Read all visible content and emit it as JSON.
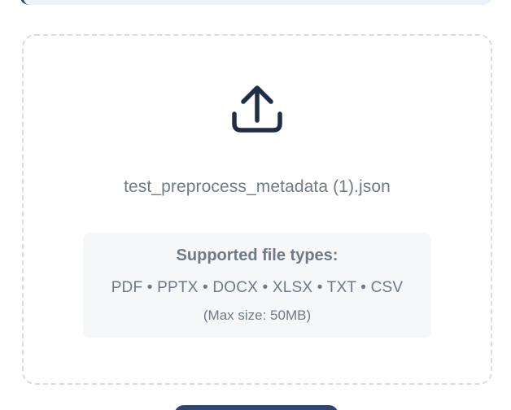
{
  "upload": {
    "icon": "upload-icon",
    "file_name": "test_preprocess_metadata (1).json",
    "supported": {
      "title": "Supported file types:",
      "types": "PDF • PPTX • DOCX • XLSX • TXT • CSV",
      "max_size": "(Max size: 50MB)"
    }
  },
  "colors": {
    "icon": "#1f2d47",
    "text": "#6f7a86",
    "border": "#d9dde2",
    "info_bg": "#f5f7f9",
    "button": "#2f4770"
  }
}
